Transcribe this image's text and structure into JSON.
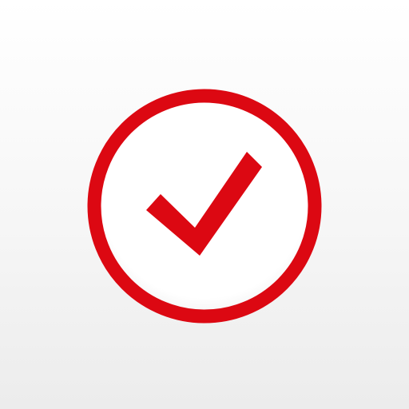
{
  "icon": {
    "name": "checkmark-circle-icon",
    "colors": {
      "accent": "#dc0812",
      "circle_fill": "#ffffff",
      "background_top": "#ffffff",
      "background_bottom": "#ececec"
    }
  }
}
